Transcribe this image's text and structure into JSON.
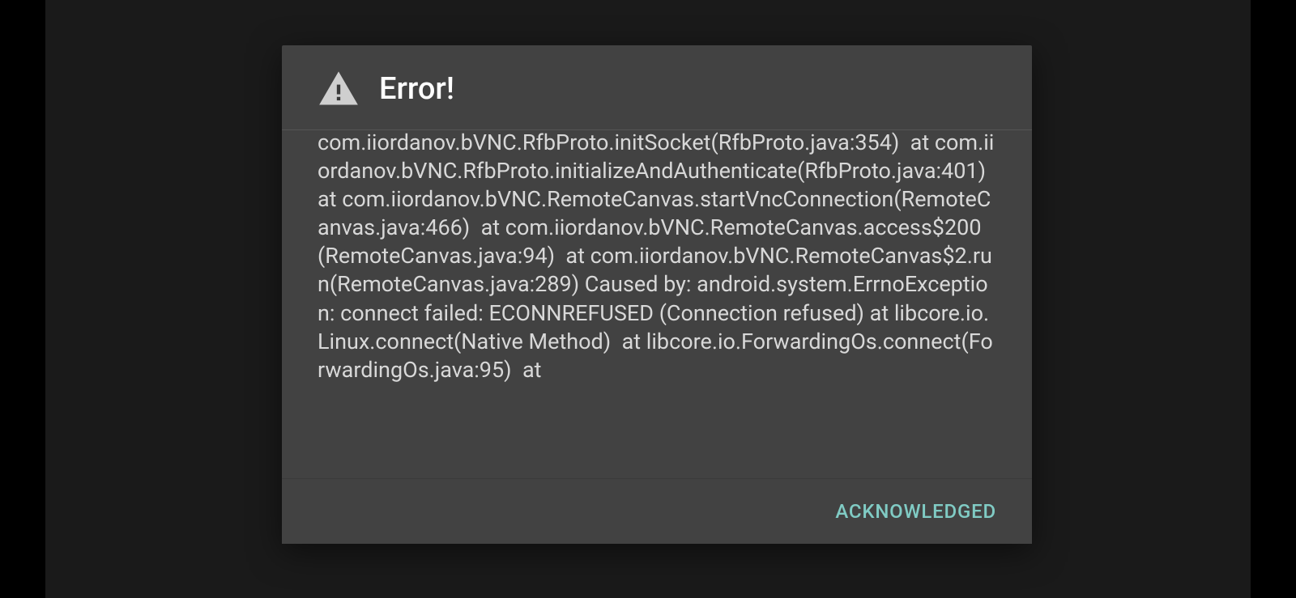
{
  "dialog": {
    "title": "Error!",
    "body": "com.iiordanov.bVNC.RfbProto.initSocket(RfbProto.java:354)  at com.iiordanov.bVNC.RfbProto.initializeAndAuthenticate(RfbProto.java:401)  at com.iiordanov.bVNC.RemoteCanvas.startVncConnection(RemoteCanvas.java:466)  at com.iiordanov.bVNC.RemoteCanvas.access$200(RemoteCanvas.java:94)  at com.iiordanov.bVNC.RemoteCanvas$2.run(RemoteCanvas.java:289) Caused by: android.system.ErrnoException: connect failed: ECONNREFUSED (Connection refused) at libcore.io.Linux.connect(Native Method)  at libcore.io.ForwardingOs.connect(ForwardingOs.java:95)  at",
    "ack_label": "ACKNOWLEDGED"
  },
  "icons": {
    "warning": "warning-icon"
  },
  "colors": {
    "accent": "#80cbc4",
    "dialog_bg": "#424242",
    "backdrop": "#1a1a1a"
  }
}
